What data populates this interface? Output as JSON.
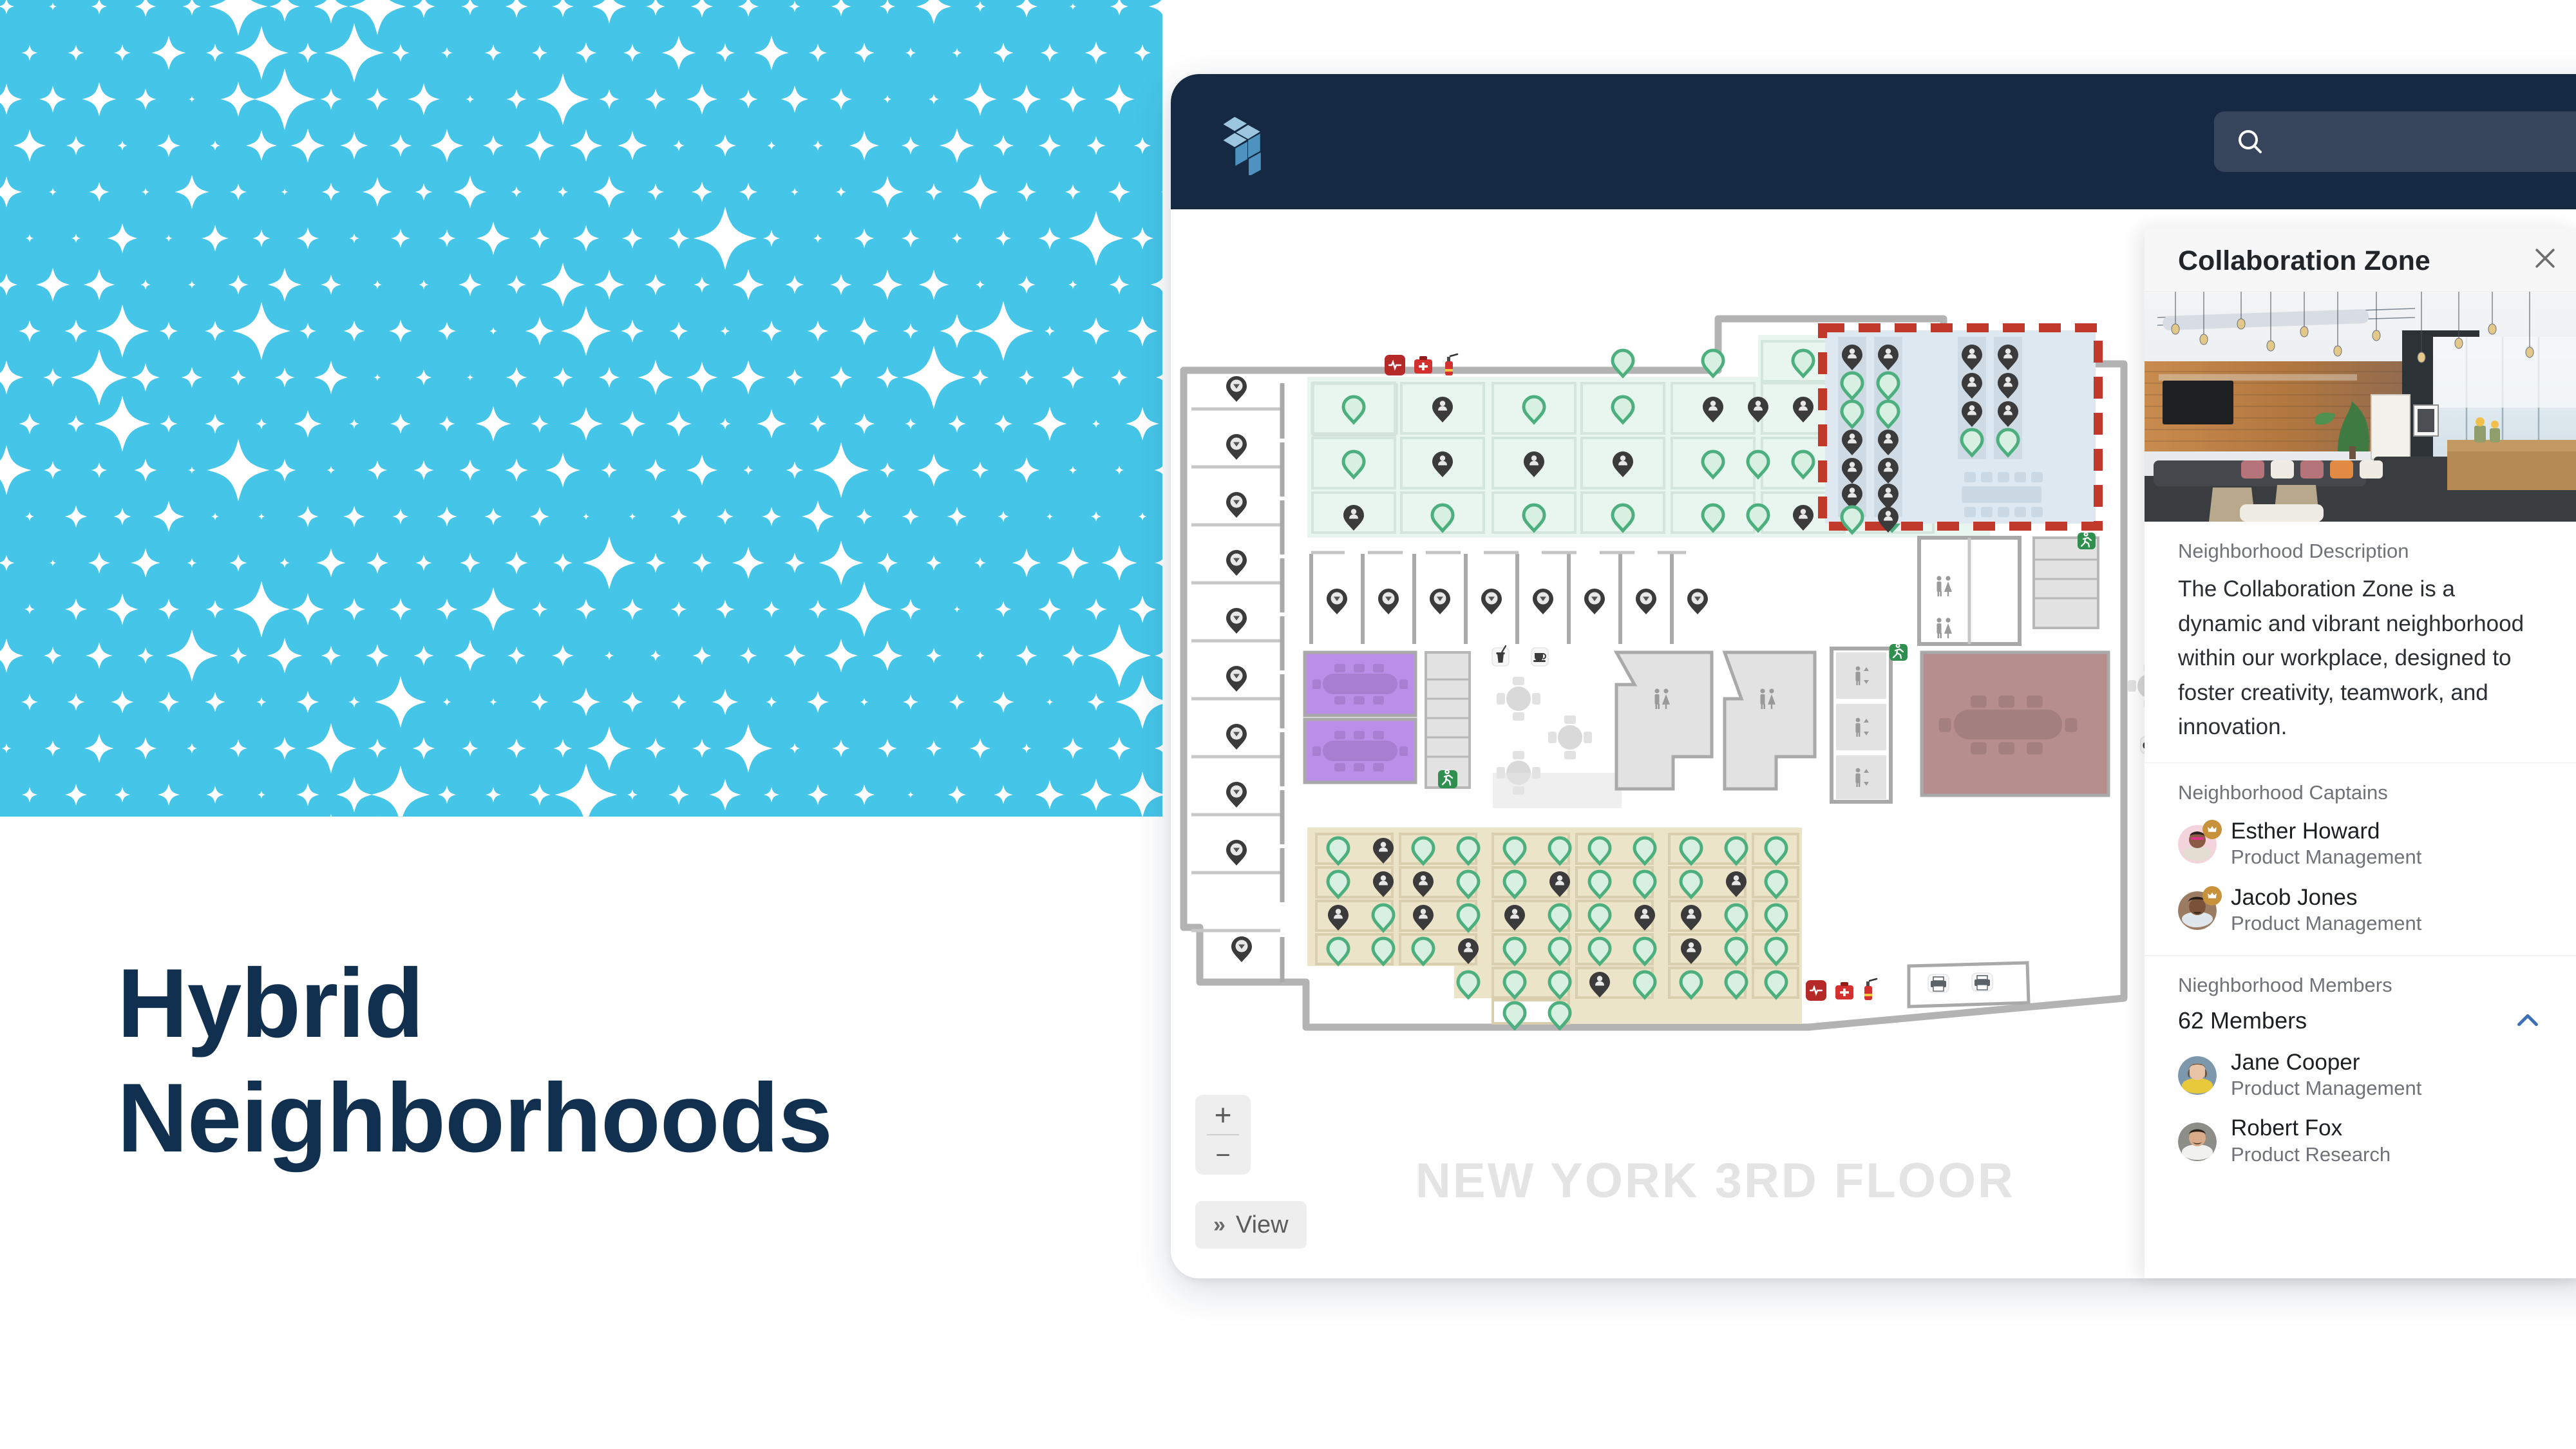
{
  "hero": {
    "background_color": "#45c5e8",
    "headline_lines": [
      "Hybrid",
      "Neighborhoods"
    ],
    "headline_color": "#11304f",
    "sparkle_color": "#ffffff"
  },
  "app": {
    "topbar_color": "#152a42",
    "logo_name": "isometric-blocks-logo",
    "search": {
      "value": "",
      "placeholder": ""
    }
  },
  "floorplan": {
    "label": "NEW YORK 3RD FLOOR",
    "zoom_in_label": "+",
    "zoom_out_label": "−",
    "view_button_label": "View",
    "view_button_chevron": "»",
    "selected_zone_outline_color": "#c0392b",
    "zones": [
      {
        "name": "green-desk-neighborhood",
        "fill": "#e8f6ef"
      },
      {
        "name": "collaboration-zone-selected",
        "fill": "#dde8f0"
      },
      {
        "name": "beige-desk-neighborhood",
        "fill": "#ece4c8"
      },
      {
        "name": "purple-meeting-rooms",
        "fill": "#bb8ee8"
      },
      {
        "name": "mauve-boardroom",
        "fill": "#b68e8e"
      }
    ],
    "pin_legend": [
      {
        "name": "available-desk-pin",
        "color": "#4caf7d",
        "meaning": "Available"
      },
      {
        "name": "occupied-desk-pin",
        "color": "#3b3b3b",
        "meaning": "Occupied"
      },
      {
        "name": "room-pin",
        "color": "#3b3b3b",
        "meaning": "Room"
      }
    ],
    "amenity_icons": [
      "heart-monitor-icon",
      "first-aid-kit-icon",
      "fire-extinguisher-icon",
      "emergency-exit-icon",
      "drink-icon",
      "coffee-icon",
      "restroom-icon",
      "elevator-icon",
      "printer-icon",
      "game-controller-icon"
    ]
  },
  "panel": {
    "title": "Collaboration Zone",
    "close_icon": "close-icon",
    "photo_alt": "collaboration-zone-photo",
    "description_label": "Neighborhood Description",
    "description": "The Collaboration Zone is a dynamic and vibrant neighborhood within our workplace, designed to foster creativity, teamwork, and innovation.",
    "captains_label": "Neighborhood Captains",
    "captains": [
      {
        "name": "Esther Howard",
        "role": "Product Management"
      },
      {
        "name": "Jacob Jones",
        "role": "Product Management"
      }
    ],
    "members_label": "Nieghborhood Members",
    "members_count": "62 Members",
    "members_collapse_icon": "chevron-up-icon",
    "members": [
      {
        "name": "Jane Cooper",
        "role": "Product Management"
      },
      {
        "name": "Robert Fox",
        "role": "Product Research"
      }
    ]
  }
}
